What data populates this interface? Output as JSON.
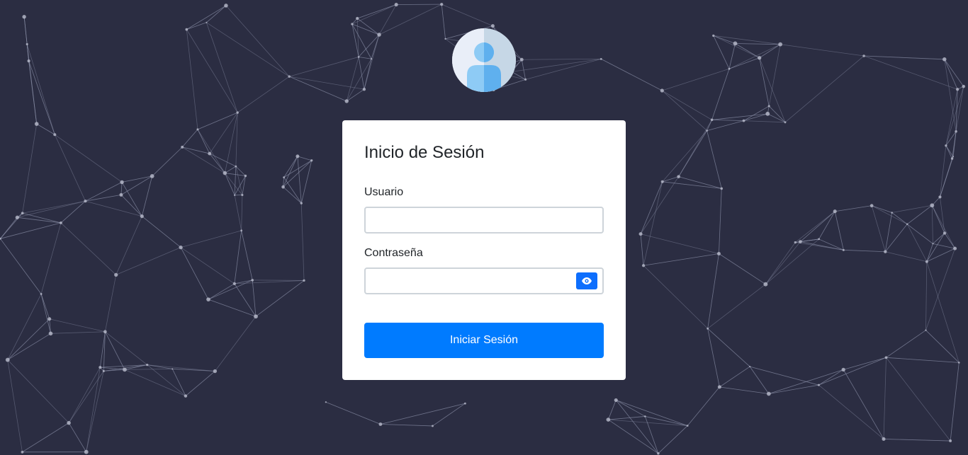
{
  "login": {
    "title": "Inicio de Sesión",
    "username_label": "Usuario",
    "username_value": "",
    "password_label": "Contraseña",
    "password_value": "",
    "submit_label": "Iniciar Sesión"
  },
  "icons": {
    "avatar": "user-avatar-icon",
    "toggle_password": "eye-icon"
  },
  "colors": {
    "background": "#2b2d42",
    "network_lines": "#8a8ea6",
    "card": "#ffffff",
    "primary_button": "#007bff",
    "eye_button": "#0d6efd",
    "avatar_light": "#8ecbf5",
    "avatar_dark": "#5fb0ee"
  }
}
